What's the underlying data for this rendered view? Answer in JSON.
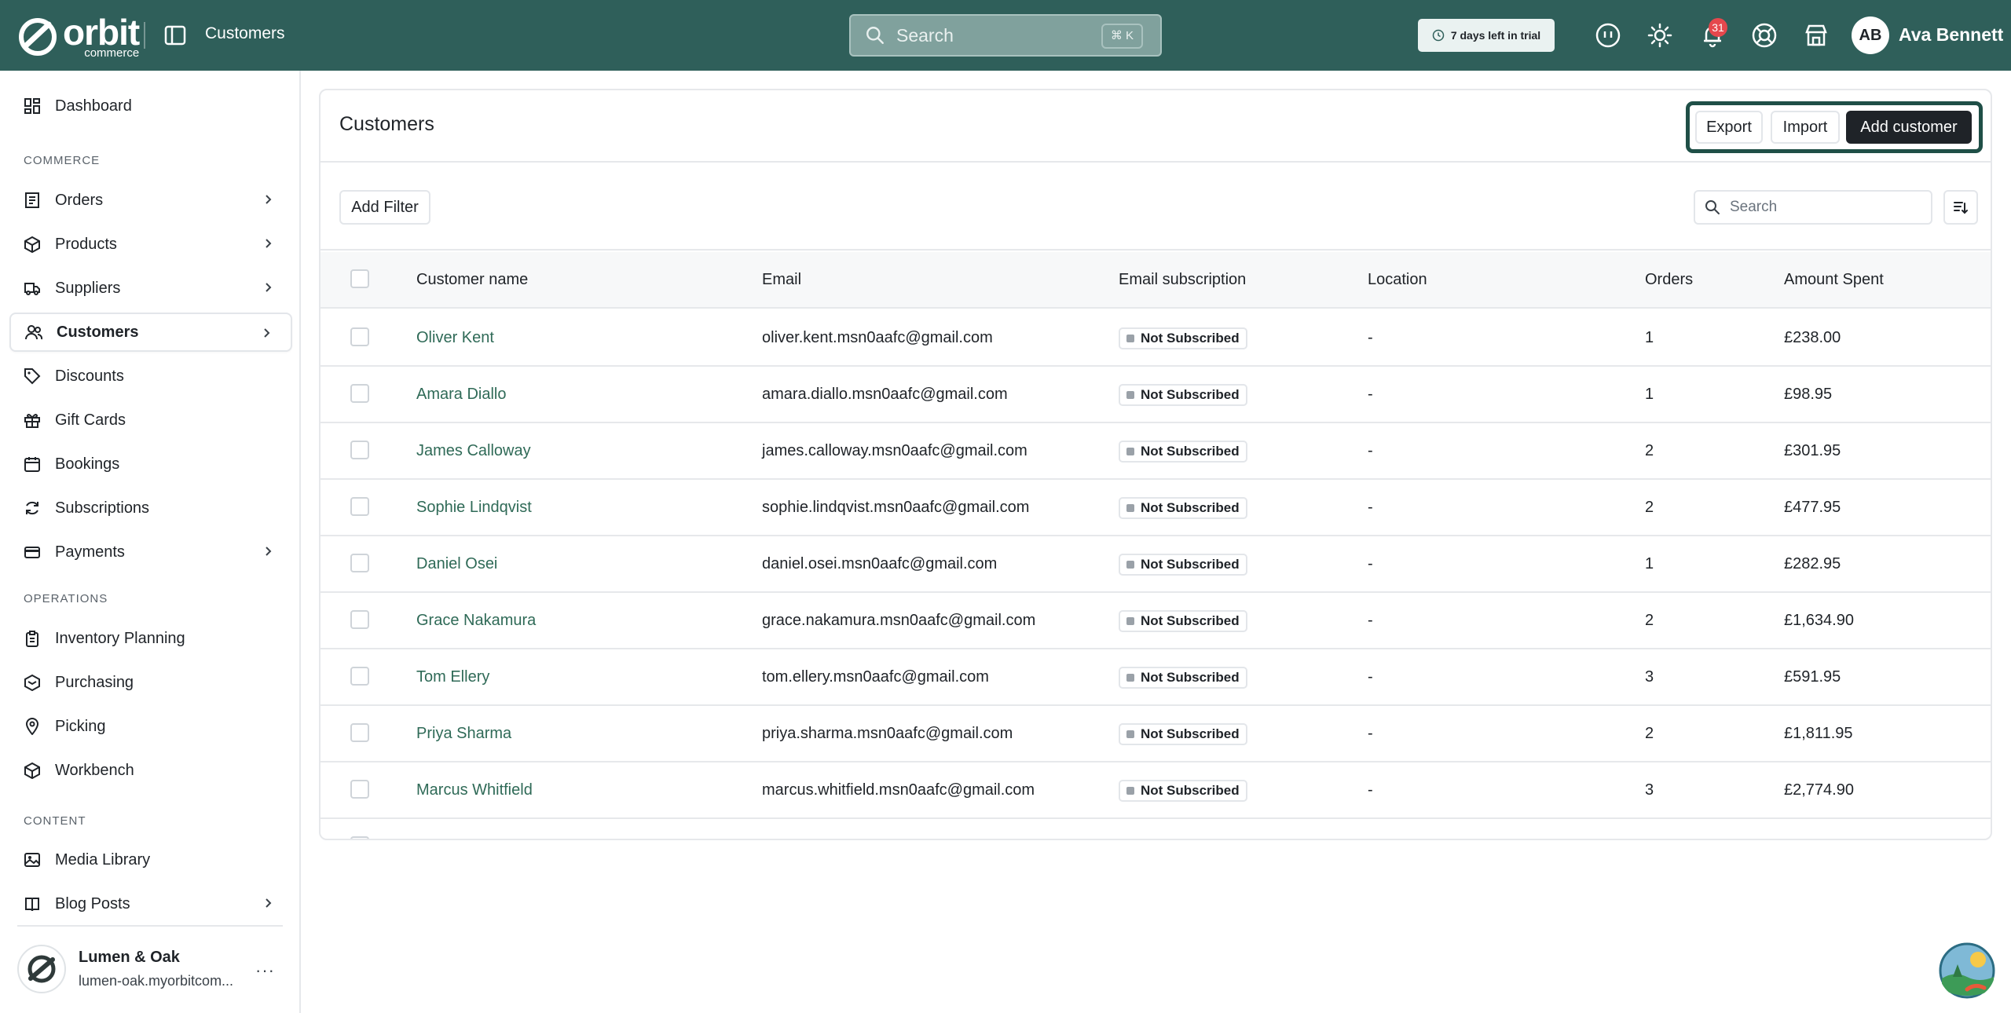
{
  "app": {
    "logo_word": "orbit",
    "logo_sub": "commerce",
    "breadcrumb": "Customers",
    "search_placeholder": "Search",
    "search_shortcut": "⌘ K",
    "trial_text": "7 days left in trial",
    "notifications_count": "31",
    "user_initials": "AB",
    "user_name": "Ava Bennett"
  },
  "sidebar": {
    "dashboard": "Dashboard",
    "section_commerce": "COMMERCE",
    "commerce_items": [
      {
        "label": "Orders",
        "icon": "orders-icon",
        "chevron": true
      },
      {
        "label": "Products",
        "icon": "box-icon",
        "chevron": true
      },
      {
        "label": "Suppliers",
        "icon": "truck-icon",
        "chevron": true
      },
      {
        "label": "Customers",
        "icon": "users-icon",
        "chevron": true,
        "active": true
      },
      {
        "label": "Discounts",
        "icon": "tag-icon",
        "chevron": false
      },
      {
        "label": "Gift Cards",
        "icon": "gift-icon",
        "chevron": false
      },
      {
        "label": "Bookings",
        "icon": "calendar-icon",
        "chevron": false
      },
      {
        "label": "Subscriptions",
        "icon": "refresh-icon",
        "chevron": false
      },
      {
        "label": "Payments",
        "icon": "card-icon",
        "chevron": true
      }
    ],
    "section_operations": "OPERATIONS",
    "operations_items": [
      {
        "label": "Inventory Planning",
        "icon": "clipboard-icon"
      },
      {
        "label": "Purchasing",
        "icon": "purchase-icon"
      },
      {
        "label": "Picking",
        "icon": "pin-icon"
      },
      {
        "label": "Workbench",
        "icon": "cube-icon"
      }
    ],
    "section_content": "CONTENT",
    "content_items": [
      {
        "label": "Media Library",
        "icon": "image-icon",
        "chevron": false
      },
      {
        "label": "Blog Posts",
        "icon": "book-icon",
        "chevron": true
      }
    ],
    "store_name": "Lumen & Oak",
    "store_url": "lumen-oak.myorbitcom...",
    "store_more": "···"
  },
  "page": {
    "title": "Customers",
    "export_label": "Export",
    "import_label": "Import",
    "add_customer_label": "Add customer",
    "add_filter_label": "Add Filter",
    "table_search_placeholder": "Search"
  },
  "table": {
    "columns": [
      "Customer name",
      "Email",
      "Email subscription",
      "Location",
      "Orders",
      "Amount Spent"
    ],
    "rows": [
      {
        "name": "Oliver Kent",
        "email": "oliver.kent.msn0aafc@gmail.com",
        "subscription": "Not Subscribed",
        "location": "-",
        "orders": "1",
        "amount": "£238.00"
      },
      {
        "name": "Amara Diallo",
        "email": "amara.diallo.msn0aafc@gmail.com",
        "subscription": "Not Subscribed",
        "location": "-",
        "orders": "1",
        "amount": "£98.95"
      },
      {
        "name": "James Calloway",
        "email": "james.calloway.msn0aafc@gmail.com",
        "subscription": "Not Subscribed",
        "location": "-",
        "orders": "2",
        "amount": "£301.95"
      },
      {
        "name": "Sophie Lindqvist",
        "email": "sophie.lindqvist.msn0aafc@gmail.com",
        "subscription": "Not Subscribed",
        "location": "-",
        "orders": "2",
        "amount": "£477.95"
      },
      {
        "name": "Daniel Osei",
        "email": "daniel.osei.msn0aafc@gmail.com",
        "subscription": "Not Subscribed",
        "location": "-",
        "orders": "1",
        "amount": "£282.95"
      },
      {
        "name": "Grace Nakamura",
        "email": "grace.nakamura.msn0aafc@gmail.com",
        "subscription": "Not Subscribed",
        "location": "-",
        "orders": "2",
        "amount": "£1,634.90"
      },
      {
        "name": "Tom Ellery",
        "email": "tom.ellery.msn0aafc@gmail.com",
        "subscription": "Not Subscribed",
        "location": "-",
        "orders": "3",
        "amount": "£591.95"
      },
      {
        "name": "Priya Sharma",
        "email": "priya.sharma.msn0aafc@gmail.com",
        "subscription": "Not Subscribed",
        "location": "-",
        "orders": "2",
        "amount": "£1,811.95"
      },
      {
        "name": "Marcus Whitfield",
        "email": "marcus.whitfield.msn0aafc@gmail.com",
        "subscription": "Not Subscribed",
        "location": "-",
        "orders": "3",
        "amount": "£2,774.90"
      }
    ]
  },
  "colors": {
    "topbar": "#2f5f5a",
    "link": "#2f6a57",
    "primary_button": "#1f2328",
    "badge_notification": "#e5484d"
  }
}
